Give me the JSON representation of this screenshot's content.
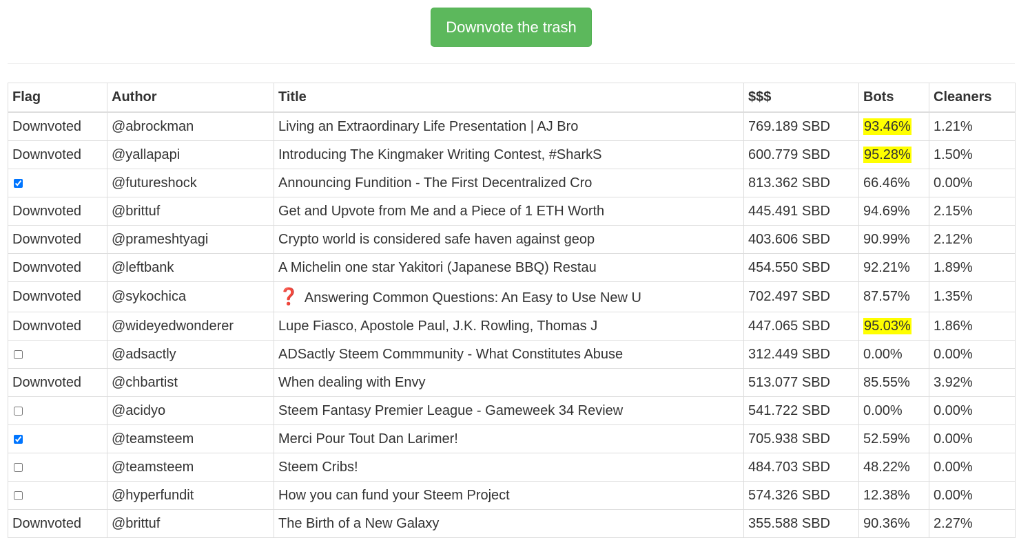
{
  "action_button": {
    "label": "Downvote the trash"
  },
  "table": {
    "headers": [
      "Flag",
      "Author",
      "Title",
      "$$$",
      "Bots",
      "Cleaners"
    ],
    "rows": [
      {
        "flag": "Downvoted",
        "checked": null,
        "author": "@abrockman",
        "icon": null,
        "title": "Living an Extraordinary Life Presentation | AJ Bro",
        "amount": "769.189 SBD",
        "bots": "93.46%",
        "bots_highlight": true,
        "cleaners": "1.21%"
      },
      {
        "flag": "Downvoted",
        "checked": null,
        "author": "@yallapapi",
        "icon": null,
        "title": "Introducing The Kingmaker Writing Contest, #SharkS",
        "amount": "600.779 SBD",
        "bots": "95.28%",
        "bots_highlight": true,
        "cleaners": "1.50%"
      },
      {
        "flag": "",
        "checked": true,
        "author": "@futureshock",
        "icon": null,
        "title": "Announcing Fundition - The First Decentralized Cro",
        "amount": "813.362 SBD",
        "bots": "66.46%",
        "bots_highlight": false,
        "cleaners": "0.00%"
      },
      {
        "flag": "Downvoted",
        "checked": null,
        "author": "@brittuf",
        "icon": null,
        "title": "Get and Upvote from Me and a Piece of 1 ETH Worth",
        "amount": "445.491 SBD",
        "bots": "94.69%",
        "bots_highlight": false,
        "cleaners": "2.15%"
      },
      {
        "flag": "Downvoted",
        "checked": null,
        "author": "@prameshtyagi",
        "icon": null,
        "title": "Crypto world is considered safe haven against geop",
        "amount": "403.606 SBD",
        "bots": "90.99%",
        "bots_highlight": false,
        "cleaners": "2.12%"
      },
      {
        "flag": "Downvoted",
        "checked": null,
        "author": "@leftbank",
        "icon": null,
        "title": "A Michelin one star Yakitori (Japanese BBQ) Restau",
        "amount": "454.550 SBD",
        "bots": "92.21%",
        "bots_highlight": false,
        "cleaners": "1.89%"
      },
      {
        "flag": "Downvoted",
        "checked": null,
        "author": "@sykochica",
        "icon": "question-mark-icon",
        "title": "Answering Common Questions: An Easy to Use New U",
        "amount": "702.497 SBD",
        "bots": "87.57%",
        "bots_highlight": false,
        "cleaners": "1.35%"
      },
      {
        "flag": "Downvoted",
        "checked": null,
        "author": "@wideyedwonderer",
        "icon": null,
        "title": "Lupe Fiasco, Apostole Paul, J.K. Rowling, Thomas J",
        "amount": "447.065 SBD",
        "bots": "95.03%",
        "bots_highlight": true,
        "cleaners": "1.86%"
      },
      {
        "flag": "",
        "checked": false,
        "author": "@adsactly",
        "icon": null,
        "title": "ADSactly Steem Commmunity - What Constitutes Abuse",
        "amount": "312.449 SBD",
        "bots": "0.00%",
        "bots_highlight": false,
        "cleaners": "0.00%"
      },
      {
        "flag": "Downvoted",
        "checked": null,
        "author": "@chbartist",
        "icon": null,
        "title": "When dealing with Envy",
        "amount": "513.077 SBD",
        "bots": "85.55%",
        "bots_highlight": false,
        "cleaners": "3.92%"
      },
      {
        "flag": "",
        "checked": false,
        "author": "@acidyo",
        "icon": null,
        "title": "Steem Fantasy Premier League - Gameweek 34 Review",
        "amount": "541.722 SBD",
        "bots": "0.00%",
        "bots_highlight": false,
        "cleaners": "0.00%"
      },
      {
        "flag": "",
        "checked": true,
        "author": "@teamsteem",
        "icon": null,
        "title": "Merci Pour Tout Dan Larimer!",
        "amount": "705.938 SBD",
        "bots": "52.59%",
        "bots_highlight": false,
        "cleaners": "0.00%"
      },
      {
        "flag": "",
        "checked": false,
        "author": "@teamsteem",
        "icon": null,
        "title": "Steem Cribs!",
        "amount": "484.703 SBD",
        "bots": "48.22%",
        "bots_highlight": false,
        "cleaners": "0.00%"
      },
      {
        "flag": "",
        "checked": false,
        "author": "@hyperfundit",
        "icon": null,
        "title": "How you can fund your Steem Project",
        "amount": "574.326 SBD",
        "bots": "12.38%",
        "bots_highlight": false,
        "cleaners": "0.00%"
      },
      {
        "flag": "Downvoted",
        "checked": null,
        "author": "@brittuf",
        "icon": null,
        "title": "The Birth of a New Galaxy",
        "amount": "355.588 SBD",
        "bots": "90.36%",
        "bots_highlight": false,
        "cleaners": "2.27%"
      }
    ]
  }
}
